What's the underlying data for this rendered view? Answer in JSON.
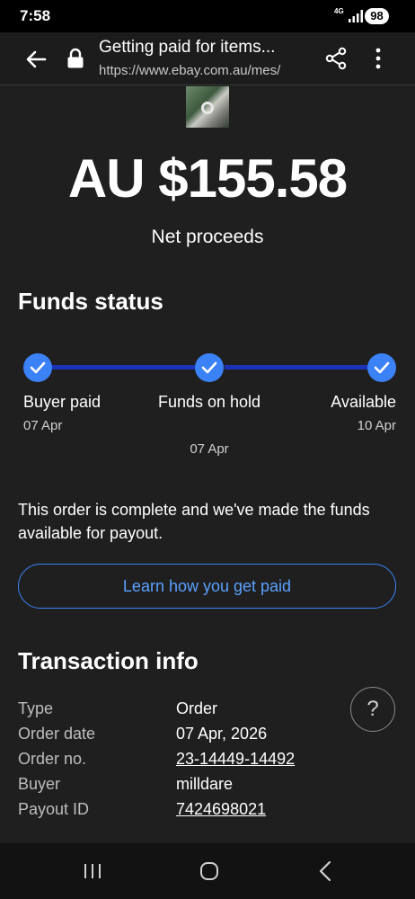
{
  "status_bar": {
    "time": "7:58",
    "network": "4G",
    "battery": "98"
  },
  "browser": {
    "page_title": "Getting paid for items...",
    "url": "https://www.ebay.com.au/mes/",
    "icons": [
      "back-arrow-icon",
      "lock-icon",
      "share-icon",
      "more-vert-icon"
    ]
  },
  "summary": {
    "amount": "AU $155.58",
    "amount_label": "Net proceeds"
  },
  "funds_status": {
    "title": "Funds status",
    "steps": [
      {
        "label": "Buyer paid",
        "date": "07 Apr",
        "complete": true
      },
      {
        "label": "Funds on hold",
        "date": "07 Apr",
        "complete": true
      },
      {
        "label": "Available",
        "date": "10 Apr",
        "complete": true
      }
    ],
    "description": "This order is complete and we've made the funds available for payout.",
    "learn_button": "Learn how you get paid"
  },
  "transaction": {
    "title": "Transaction info",
    "rows": [
      {
        "key": "Type",
        "value": "Order"
      },
      {
        "key": "Order date",
        "value": "07 Apr, 2026"
      },
      {
        "key": "Order no.",
        "value": "23-14449-14492"
      },
      {
        "key": "Buyer",
        "value": "milldare"
      },
      {
        "key": "Payout ID",
        "value": "7424698021"
      }
    ]
  },
  "help_button": "?",
  "colors": {
    "background": "#1f1f1f",
    "accent": "#3b82f6",
    "progress_line": "#1a33b8",
    "link": "#5aa0ff"
  }
}
